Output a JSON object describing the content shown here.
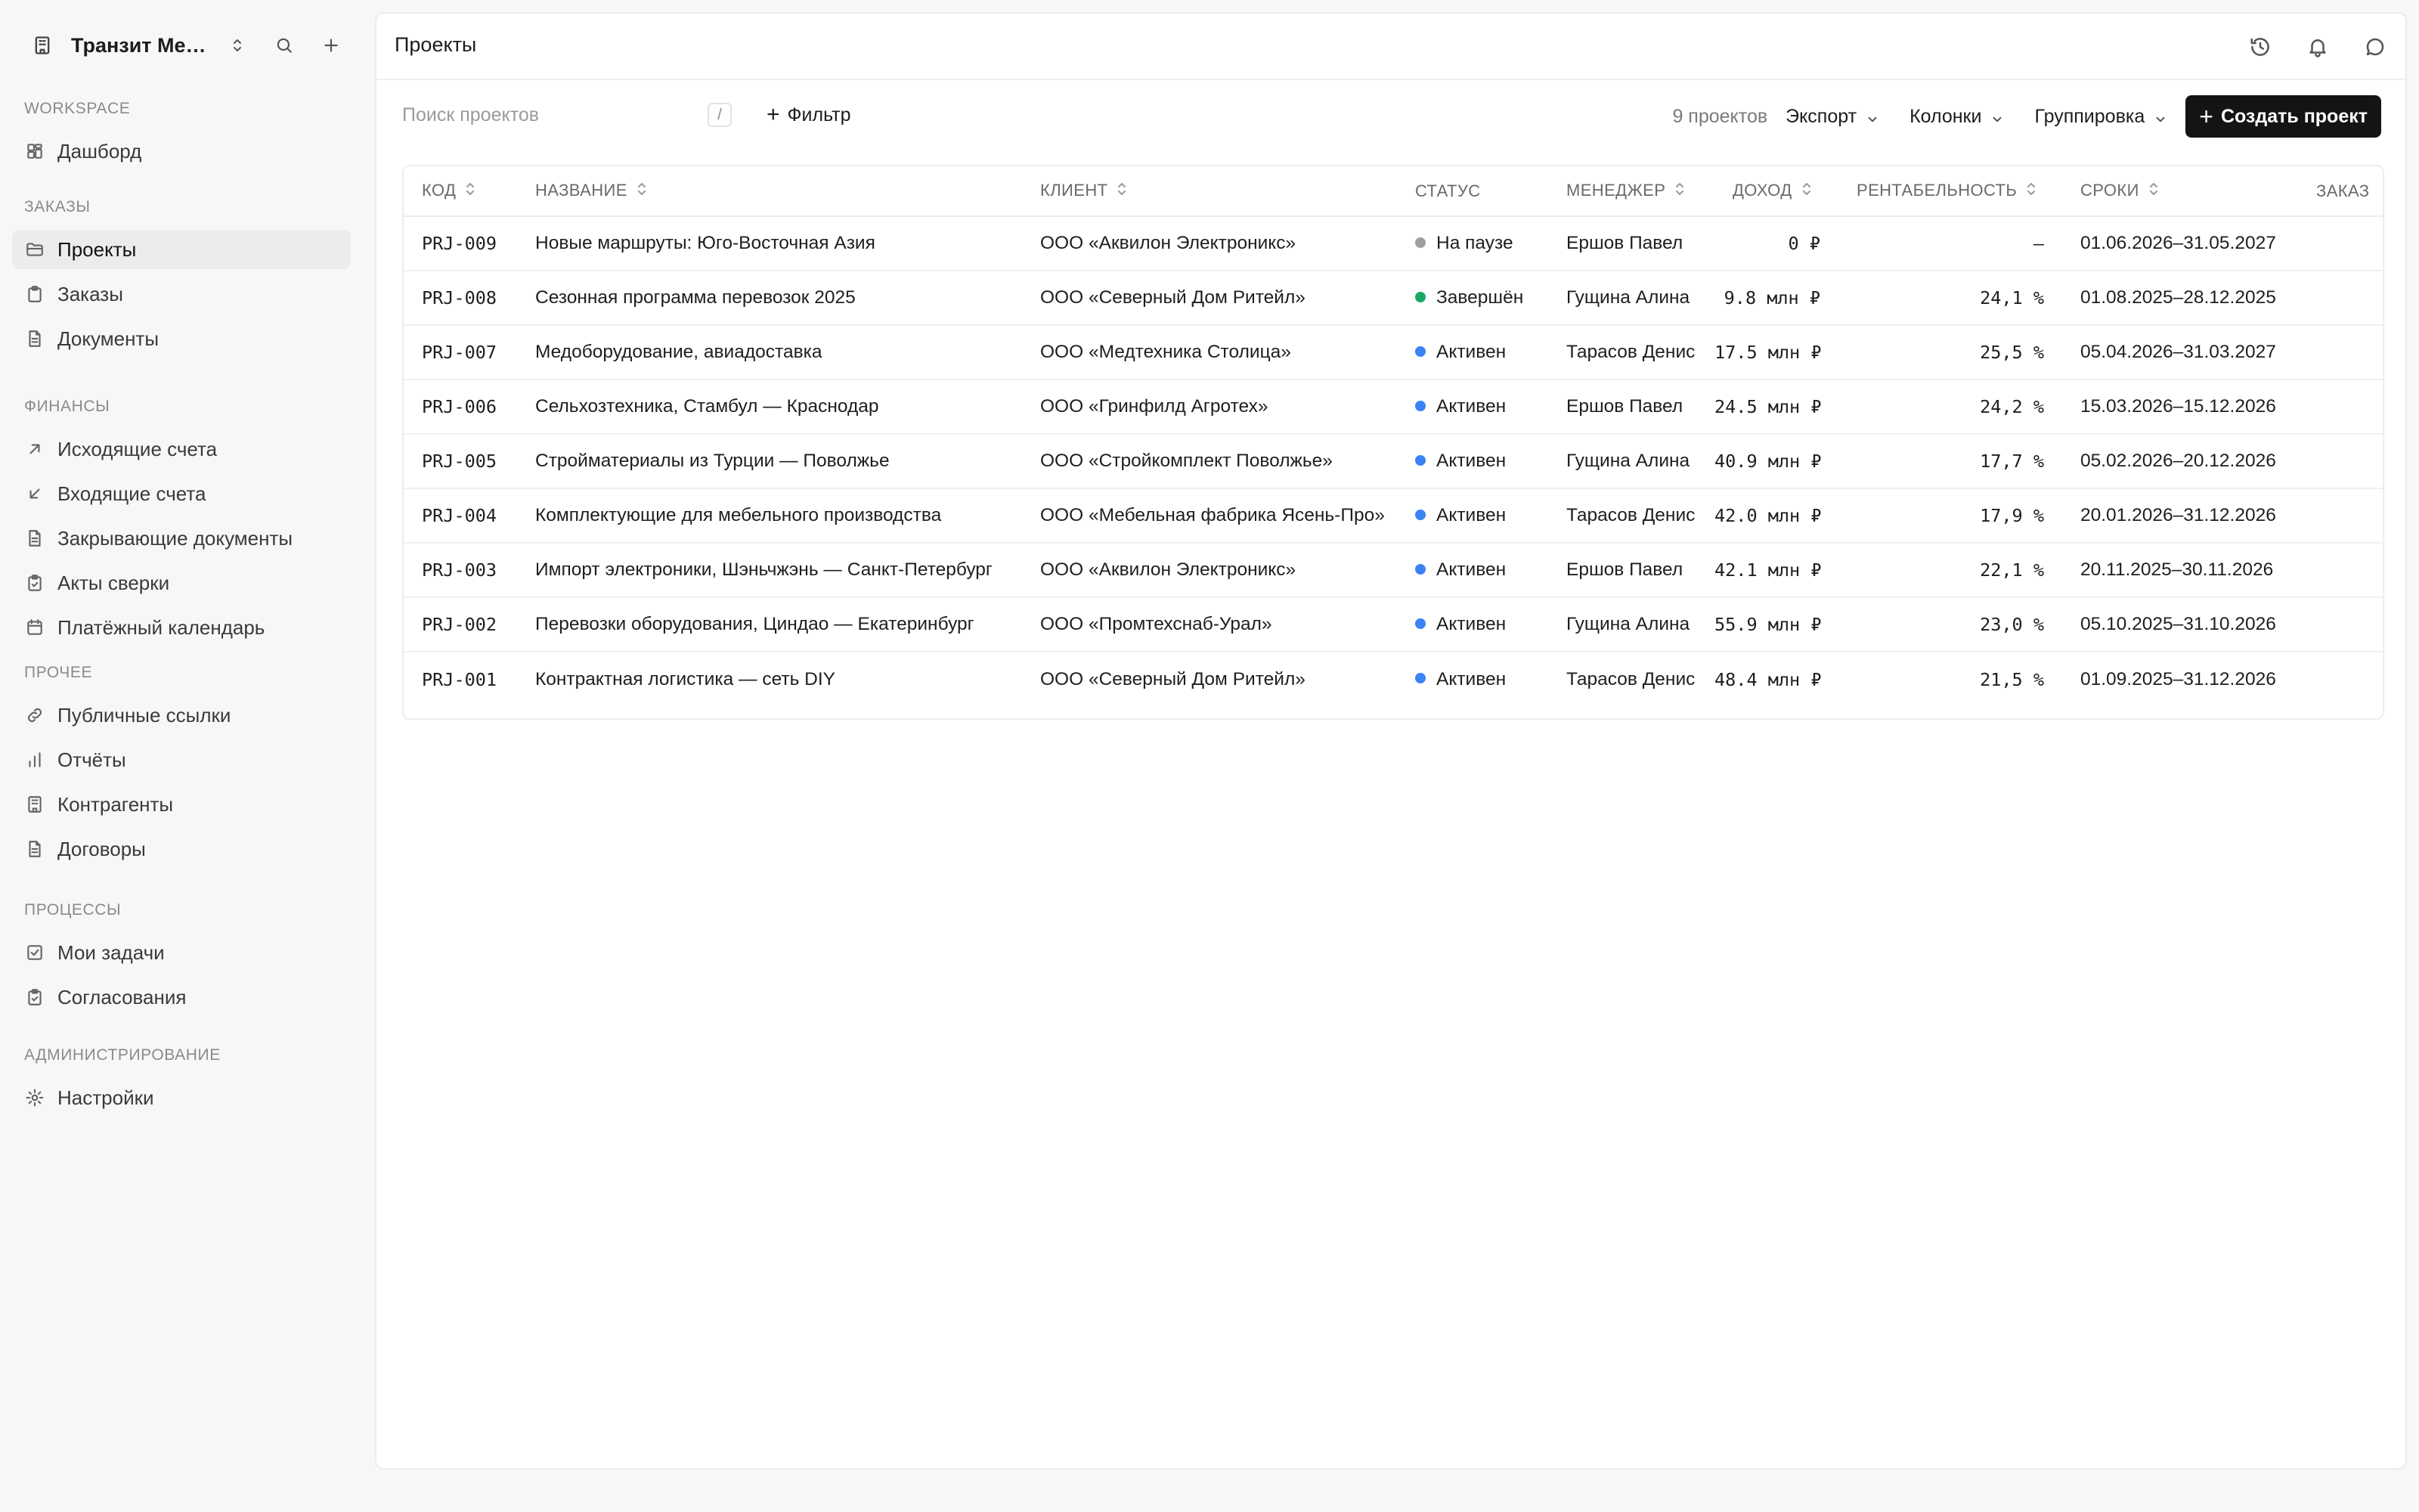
{
  "workspace": {
    "name": "Транзит Мер..."
  },
  "sidebar": {
    "sections": [
      {
        "title": "WORKSPACE",
        "items": [
          {
            "label": "Дашборд",
            "icon": "dashboard-icon",
            "active": false
          }
        ]
      },
      {
        "title": "ЗАКАЗЫ",
        "items": [
          {
            "label": "Проекты",
            "icon": "folder-icon",
            "active": true
          },
          {
            "label": "Заказы",
            "icon": "clipboard-icon",
            "active": false
          },
          {
            "label": "Документы",
            "icon": "document-icon",
            "active": false
          }
        ]
      },
      {
        "title": "ФИНАНСЫ",
        "items": [
          {
            "label": "Исходящие счета",
            "icon": "arrow-up-right-icon",
            "active": false
          },
          {
            "label": "Входящие счета",
            "icon": "arrow-down-left-icon",
            "active": false
          },
          {
            "label": "Закрывающие документы",
            "icon": "document-icon",
            "active": false
          },
          {
            "label": "Акты сверки",
            "icon": "clipboard-check-icon",
            "active": false
          },
          {
            "label": "Платёжный календарь",
            "icon": "calendar-icon",
            "active": false
          }
        ]
      },
      {
        "title": "ПРОЧЕЕ",
        "items": [
          {
            "label": "Публичные ссылки",
            "icon": "link-icon",
            "active": false
          },
          {
            "label": "Отчёты",
            "icon": "bar-chart-icon",
            "active": false
          },
          {
            "label": "Контрагенты",
            "icon": "building-icon",
            "active": false
          },
          {
            "label": "Договоры",
            "icon": "document-icon",
            "active": false
          }
        ]
      },
      {
        "title": "ПРОЦЕССЫ",
        "items": [
          {
            "label": "Мои задачи",
            "icon": "checkbox-icon",
            "active": false
          },
          {
            "label": "Согласования",
            "icon": "clipboard-check-icon",
            "active": false
          }
        ]
      },
      {
        "title": "АДМИНИСТРИРОВАНИЕ",
        "items": [
          {
            "label": "Настройки",
            "icon": "gear-icon",
            "active": false
          }
        ]
      }
    ]
  },
  "header": {
    "title": "Проекты"
  },
  "toolbar": {
    "search_placeholder": "Поиск проектов",
    "search_shortcut": "/",
    "filter_label": "Фильтр",
    "count_text": "9 проектов",
    "export_label": "Экспорт",
    "columns_label": "Колонки",
    "grouping_label": "Группировка",
    "create_label": "Создать проект"
  },
  "table": {
    "headers": [
      "КОД",
      "НАЗВАНИЕ",
      "КЛИЕНТ",
      "СТАТУС",
      "МЕНЕДЖЕР",
      "ДОХОД",
      "РЕНТАБЕЛЬНОСТЬ",
      "СРОКИ",
      "ЗАКАЗ"
    ],
    "status_colors": {
      "На паузе": "#9e9e9e",
      "Завершён": "#1aa866",
      "Активен": "#3b82f6"
    },
    "rows": [
      {
        "code": "PRJ-009",
        "name": "Новые маршруты: Юго-Восточная Азия",
        "client": "ООО «Аквилон Электроникс»",
        "status": "На паузе",
        "manager": "Ершов Павел",
        "income": "0 ₽",
        "margin": "—",
        "dates": "01.06.2026–31.05.2027"
      },
      {
        "code": "PRJ-008",
        "name": "Сезонная программа перевозок 2025",
        "client": "ООО «Северный Дом Ритейл»",
        "status": "Завершён",
        "manager": "Гущина Алина",
        "income": "9.8 млн ₽",
        "margin": "24,1 %",
        "dates": "01.08.2025–28.12.2025"
      },
      {
        "code": "PRJ-007",
        "name": "Медоборудование, авиадоставка",
        "client": "ООО «Медтехника Столица»",
        "status": "Активен",
        "manager": "Тарасов Денис",
        "income": "17.5 млн ₽",
        "margin": "25,5 %",
        "dates": "05.04.2026–31.03.2027"
      },
      {
        "code": "PRJ-006",
        "name": "Сельхозтехника, Стамбул — Краснодар",
        "client": "ООО «Гринфилд Агротех»",
        "status": "Активен",
        "manager": "Ершов Павел",
        "income": "24.5 млн ₽",
        "margin": "24,2 %",
        "dates": "15.03.2026–15.12.2026"
      },
      {
        "code": "PRJ-005",
        "name": "Стройматериалы из Турции — Поволжье",
        "client": "ООО «Стройкомплект Поволжье»",
        "status": "Активен",
        "manager": "Гущина Алина",
        "income": "40.9 млн ₽",
        "margin": "17,7 %",
        "dates": "05.02.2026–20.12.2026"
      },
      {
        "code": "PRJ-004",
        "name": "Комплектующие для мебельного производства",
        "client": "ООО «Мебельная фабрика Ясень-Про»",
        "status": "Активен",
        "manager": "Тарасов Денис",
        "income": "42.0 млн ₽",
        "margin": "17,9 %",
        "dates": "20.01.2026–31.12.2026"
      },
      {
        "code": "PRJ-003",
        "name": "Импорт электроники, Шэньчжэнь — Санкт-Петербург",
        "client": "ООО «Аквилон Электроникс»",
        "status": "Активен",
        "manager": "Ершов Павел",
        "income": "42.1 млн ₽",
        "margin": "22,1 %",
        "dates": "20.11.2025–30.11.2026"
      },
      {
        "code": "PRJ-002",
        "name": "Перевозки оборудования, Циндао — Екатеринбург",
        "client": "ООО «Промтехснаб-Урал»",
        "status": "Активен",
        "manager": "Гущина Алина",
        "income": "55.9 млн ₽",
        "margin": "23,0 %",
        "dates": "05.10.2025–31.10.2026"
      },
      {
        "code": "PRJ-001",
        "name": "Контрактная логистика — сеть DIY",
        "client": "ООО «Северный Дом Ритейл»",
        "status": "Активен",
        "manager": "Тарасов Денис",
        "income": "48.4 млн ₽",
        "margin": "21,5 %",
        "dates": "01.09.2025–31.12.2026"
      }
    ]
  }
}
